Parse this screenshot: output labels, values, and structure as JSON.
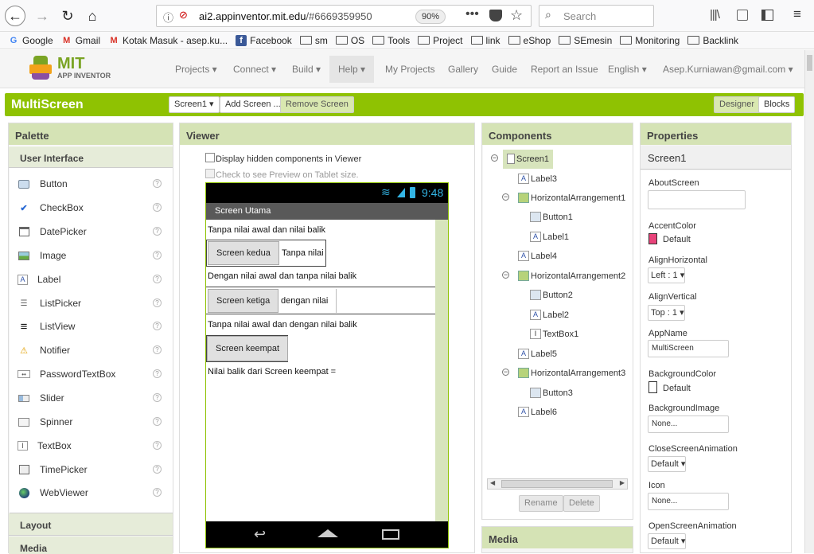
{
  "browser": {
    "url_domain": "ai2.appinventor.mit.edu",
    "url_hash": "/#6669359950",
    "zoom": "90%",
    "search_placeholder": "Search"
  },
  "bookmarks": [
    {
      "label": "Google",
      "icon": "google-icon"
    },
    {
      "label": "Gmail",
      "icon": "gmail-icon"
    },
    {
      "label": "Kotak Masuk - asep.ku...",
      "icon": "gmail-icon"
    },
    {
      "label": "Facebook",
      "icon": "facebook-icon"
    },
    {
      "label": "sm",
      "icon": "folder-icon"
    },
    {
      "label": "OS",
      "icon": "folder-icon"
    },
    {
      "label": "Tools",
      "icon": "folder-icon"
    },
    {
      "label": "Project",
      "icon": "folder-icon"
    },
    {
      "label": "link",
      "icon": "folder-icon"
    },
    {
      "label": "eShop",
      "icon": "folder-icon"
    },
    {
      "label": "SEmesin",
      "icon": "folder-icon"
    },
    {
      "label": "Monitoring",
      "icon": "folder-icon"
    },
    {
      "label": "Backlink",
      "icon": "folder-icon"
    }
  ],
  "header": {
    "logo_mit": "MIT",
    "logo_sub": "APP INVENTOR",
    "nav": {
      "projects": "Projects ▾",
      "connect": "Connect ▾",
      "build": "Build ▾",
      "help": "Help ▾",
      "my_projects": "My Projects",
      "gallery": "Gallery",
      "guide": "Guide",
      "report": "Report an Issue",
      "language": "English ▾",
      "account": "Asep.Kurniawan@gmail.com ▾"
    }
  },
  "toolbar": {
    "project_name": "MultiScreen",
    "screen_select": "Screen1 ▾",
    "add_screen": "Add Screen ...",
    "remove_screen": "Remove Screen",
    "designer": "Designer",
    "blocks": "Blocks"
  },
  "palette": {
    "title": "Palette",
    "section": "User Interface",
    "items": [
      {
        "label": "Button",
        "icon": "button-icon"
      },
      {
        "label": "CheckBox",
        "icon": "checkbox-icon"
      },
      {
        "label": "DatePicker",
        "icon": "datepicker-icon"
      },
      {
        "label": "Image",
        "icon": "image-icon"
      },
      {
        "label": "Label",
        "icon": "label-icon"
      },
      {
        "label": "ListPicker",
        "icon": "listpicker-icon"
      },
      {
        "label": "ListView",
        "icon": "listview-icon"
      },
      {
        "label": "Notifier",
        "icon": "notifier-icon"
      },
      {
        "label": "PasswordTextBox",
        "icon": "password-icon"
      },
      {
        "label": "Slider",
        "icon": "slider-icon"
      },
      {
        "label": "Spinner",
        "icon": "spinner-icon"
      },
      {
        "label": "TextBox",
        "icon": "textbox-icon"
      },
      {
        "label": "TimePicker",
        "icon": "timepicker-icon"
      },
      {
        "label": "WebViewer",
        "icon": "webviewer-icon"
      }
    ],
    "layout": "Layout",
    "media": "Media"
  },
  "viewer": {
    "title": "Viewer",
    "chk_hidden": "Display hidden components in Viewer",
    "chk_tablet": "Check to see Preview on Tablet size.",
    "time": "9:48",
    "screen_title": "Screen Utama",
    "label3": "Tanpa nilai awal dan nilai balik",
    "button1": "Screen kedua",
    "label1": "Tanpa nilai",
    "label4": "Dengan nilai awal dan tanpa nilai balik",
    "button2": "Screen ketiga",
    "label2": "dengan nilai",
    "label5": "Tanpa nilai awal dan dengan nilai balik",
    "button3": "Screen keempat",
    "label6": "Nilai balik dari Screen keempat ="
  },
  "components": {
    "title": "Components",
    "tree": {
      "screen1": "Screen1",
      "label3": "Label3",
      "ha1": "HorizontalArrangement1",
      "button1": "Button1",
      "label1": "Label1",
      "label4": "Label4",
      "ha2": "HorizontalArrangement2",
      "button2": "Button2",
      "label2": "Label2",
      "textbox1": "TextBox1",
      "label5": "Label5",
      "ha3": "HorizontalArrangement3",
      "button3": "Button3",
      "label6": "Label6"
    },
    "rename": "Rename",
    "delete": "Delete",
    "media": "Media"
  },
  "properties": {
    "title": "Properties",
    "component": "Screen1",
    "about_screen": "AboutScreen",
    "accent_color": "AccentColor",
    "accent_value": "Default",
    "accent_hex": "#e8437a",
    "align_h": "AlignHorizontal",
    "align_h_value": "Left : 1 ▾",
    "align_v": "AlignVertical",
    "align_v_value": "Top : 1 ▾",
    "app_name": "AppName",
    "app_name_value": "MultiScreen",
    "bg_color": "BackgroundColor",
    "bg_color_value": "Default",
    "bg_image": "BackgroundImage",
    "bg_image_value": "None...",
    "close_anim": "CloseScreenAnimation",
    "close_anim_value": "Default ▾",
    "icon": "Icon",
    "icon_value": "None...",
    "open_anim": "OpenScreenAnimation",
    "open_anim_value": "Default ▾"
  }
}
